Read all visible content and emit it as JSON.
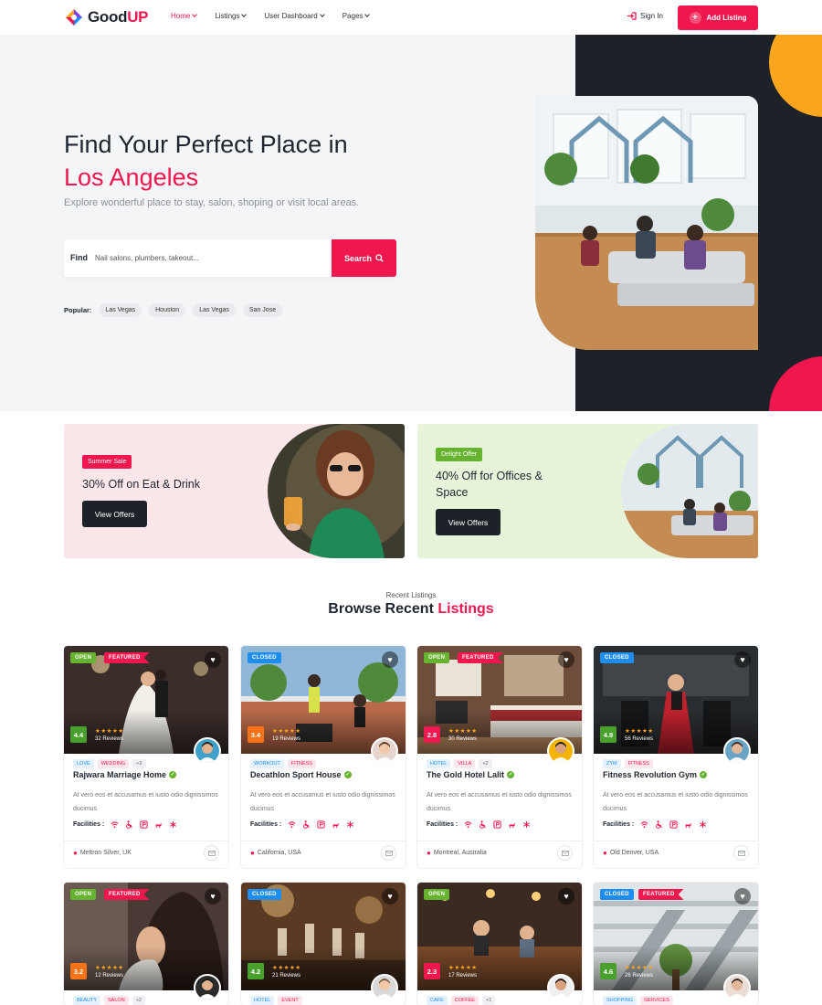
{
  "header": {
    "logo_text_a": "Good",
    "logo_text_b": "UP",
    "nav": [
      {
        "label": "Home",
        "active": true
      },
      {
        "label": "Listings",
        "active": false
      },
      {
        "label": "User Dashboard",
        "active": false
      },
      {
        "label": "Pages",
        "active": false
      }
    ],
    "signin_label": "Sign In",
    "add_listing_label": "Add Listing"
  },
  "hero": {
    "title_line1": "Find Your Perfect Place in",
    "title_line2": "Los Angeles",
    "subtitle": "Explore wonderful place to stay, salon, shoping or visit local areas.",
    "search_label": "Find",
    "search_placeholder": "Nail salons, plumbers, takeout...",
    "search_button": "Search",
    "popular_label": "Popular:",
    "popular": [
      "Las Vegas",
      "Houston",
      "Las Vegas",
      "San Jose"
    ]
  },
  "promos": [
    {
      "badge": "Summer Sale",
      "title": "30% Off on Eat & Drink",
      "button": "View Offers",
      "badge_color": "#f0164e"
    },
    {
      "badge": "Delight Offer",
      "title": "40% Off for Offices & Space",
      "button": "View Offers",
      "badge_color": "#65b32e"
    }
  ],
  "section": {
    "small": "Recent Listings",
    "title_a": "Browse Recent ",
    "title_b": "Listings"
  },
  "facilities_label": "Facilities :",
  "listing_desc": "At vero eos et accusamus et iusto odio dignissimos ducimus",
  "listings": [
    {
      "status": "OPEN",
      "featured": "FEATURED",
      "rating": "4.4",
      "rating_color": "#4aa02c",
      "reviews": "32 Reviews",
      "tags": [
        "LOVE",
        "WEDDING",
        "+2"
      ],
      "title": "Rajwara Marriage Home",
      "location": "Meltron Silver, UK"
    },
    {
      "status": "CLOSED",
      "featured": "",
      "rating": "3.4",
      "rating_color": "#f97316",
      "reviews": "19 Reviews",
      "tags": [
        "WORKOUT",
        "FITNESS"
      ],
      "title": "Decathlon Sport House",
      "location": "California, USA"
    },
    {
      "status": "OPEN",
      "featured": "FEATURED",
      "rating": "2.8",
      "rating_color": "#f0164e",
      "reviews": "30 Reviews",
      "tags": [
        "HOTEL",
        "VILLA",
        "+2"
      ],
      "title": "The Gold Hotel Lalit",
      "location": "Montreal, Australia"
    },
    {
      "status": "CLOSED",
      "featured": "",
      "rating": "4.8",
      "rating_color": "#4aa02c",
      "reviews": "56 Reviews",
      "tags": [
        "ZYM",
        "FITNESS"
      ],
      "title": "Fitness Revolution Gym",
      "location": "Old Denver, USA"
    },
    {
      "status": "OPEN",
      "featured": "FEATURED",
      "rating": "3.2",
      "rating_color": "#f97316",
      "reviews": "12 Reviews",
      "tags": [
        "BEAUTY",
        "SALON",
        "+2"
      ],
      "title": "",
      "location": ""
    },
    {
      "status": "CLOSED",
      "featured": "",
      "rating": "4.2",
      "rating_color": "#4aa02c",
      "reviews": "21 Reviews",
      "tags": [
        "HOTEL",
        "EVENT"
      ],
      "title": "",
      "location": ""
    },
    {
      "status": "OPEN",
      "featured": "",
      "rating": "2.3",
      "rating_color": "#f0164e",
      "reviews": "17 Reviews",
      "tags": [
        "CAFE",
        "COFFEE",
        "+1"
      ],
      "title": "",
      "location": ""
    },
    {
      "status": "CLOSED",
      "featured": "FEATURED",
      "rating": "4.6",
      "rating_color": "#4aa02c",
      "reviews": "26 Reviews",
      "tags": [
        "SHOPPING",
        "SERVICES"
      ],
      "title": "",
      "location": ""
    }
  ],
  "colors": {
    "accent": "#f0164e",
    "dark": "#1c2228",
    "orange": "#f9a51e",
    "green": "#65b32e",
    "blue": "#1d8ef0"
  }
}
